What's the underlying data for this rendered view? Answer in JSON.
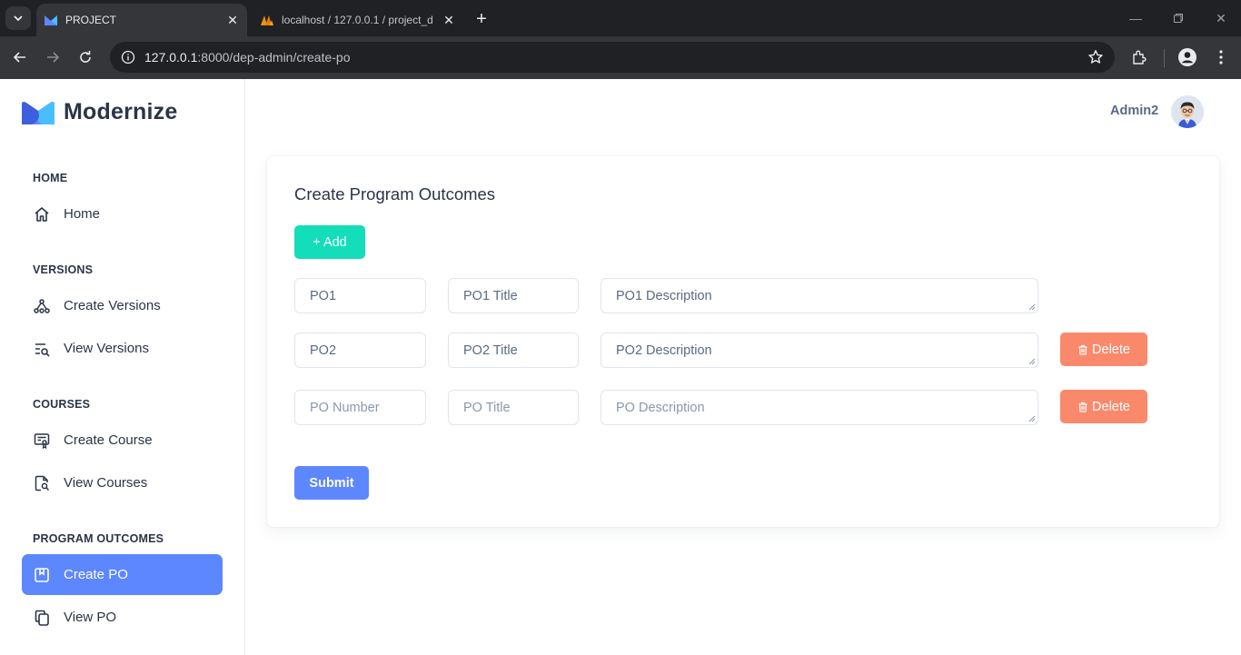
{
  "browser": {
    "tabs": [
      {
        "title": "PROJECT",
        "active": true
      },
      {
        "title": "localhost / 127.0.0.1 / project_d",
        "active": false
      }
    ],
    "url_host": "127.0.0.1",
    "url_path": ":8000/dep-admin/create-po"
  },
  "app": {
    "brand": "Modernize",
    "brand_colors": {
      "primary": "#5d87ff",
      "secondary": "#49beff"
    }
  },
  "sidebar": {
    "sections": [
      {
        "heading": "HOME",
        "items": [
          {
            "label": "Home",
            "icon": "home-icon"
          }
        ]
      },
      {
        "heading": "VERSIONS",
        "items": [
          {
            "label": "Create Versions",
            "icon": "hierarchy-icon"
          },
          {
            "label": "View Versions",
            "icon": "list-search-icon"
          }
        ]
      },
      {
        "heading": "COURSES",
        "items": [
          {
            "label": "Create Course",
            "icon": "certificate-icon"
          },
          {
            "label": "View Courses",
            "icon": "file-search-icon"
          }
        ]
      },
      {
        "heading": "PROGRAM OUTCOMES",
        "items": [
          {
            "label": "Create PO",
            "icon": "bookmark-box-icon",
            "active": true
          },
          {
            "label": "View PO",
            "icon": "copy-icon"
          }
        ]
      }
    ]
  },
  "header": {
    "user_name": "Admin2"
  },
  "form": {
    "title": "Create Program Outcomes",
    "add_label": "+ Add",
    "delete_label": "Delete",
    "submit_label": "Submit",
    "rows": [
      {
        "number": "PO1",
        "title": "PO1 Title",
        "description": "PO1 Description",
        "deletable": false
      },
      {
        "number": "PO2",
        "title": "PO2 Title",
        "description": "PO2 Description",
        "deletable": true
      },
      {
        "number": "",
        "title": "",
        "description": "",
        "deletable": true
      }
    ],
    "placeholders": {
      "number": "PO Number",
      "title": "PO Title",
      "description": "PO Description"
    },
    "colors": {
      "add": "#13deb9",
      "delete": "#fa896b",
      "submit": "#5d87ff",
      "active_nav": "#5d87ff"
    }
  }
}
